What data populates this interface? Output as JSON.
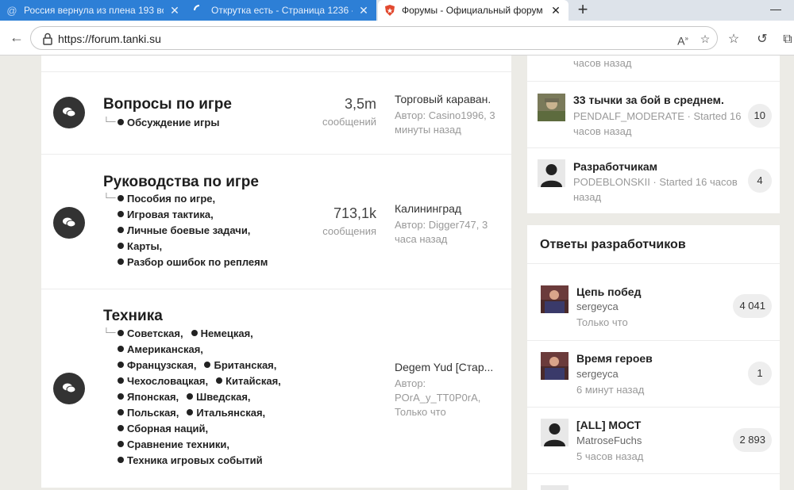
{
  "browser": {
    "tabs": [
      {
        "label": "Россия вернула из плена 193 вое",
        "icon": "at-icon"
      },
      {
        "label": "Открутка есть - Страница 1236 -",
        "icon": "loading-icon"
      },
      {
        "label": "Форумы - Официальный форум",
        "icon": "tanki-shield-icon"
      }
    ],
    "url": "https://forum.tanki.su"
  },
  "forums": [
    {
      "title": "Вопросы по игре",
      "subforums": [
        [
          "Обсуждение игры"
        ]
      ],
      "count": "3,5m",
      "count_label": "сообщений",
      "last_title": "Торговый караван.",
      "last_meta": "Автор: Casino1996, 3 минуты назад"
    },
    {
      "title": "Руководства по игре",
      "subforums": [
        [
          "Пособия по игре,"
        ],
        [
          "Игровая тактика,"
        ],
        [
          "Личные боевые задачи,"
        ],
        [
          "Карты,"
        ],
        [
          "Разбор ошибок по реплеям"
        ]
      ],
      "count": "713,1k",
      "count_label": "сообщения",
      "last_title": "Калининград",
      "last_meta": "Автор: Digger747, 3 часа назад"
    },
    {
      "title": "Техника",
      "subforums": [
        [
          "Советская,",
          "Немецкая,"
        ],
        [
          "Американская,"
        ],
        [
          "Французская,",
          "Британская,"
        ],
        [
          "Чехословацкая,",
          "Китайская,"
        ],
        [
          "Японская,",
          "Шведская,"
        ],
        [
          "Польская,",
          "Итальянская,"
        ],
        [
          "Сборная наций,"
        ],
        [
          "Сравнение техники,"
        ],
        [
          "Техника игровых событий"
        ]
      ],
      "count": "",
      "count_label": "",
      "last_title": "Degem Yud [Стар...",
      "last_meta": "Автор: POrA_y_TT0P0rA, Только что"
    }
  ],
  "popular": {
    "top_fragment": "часов назад",
    "items": [
      {
        "title": "33 тычки за бой в среднем.",
        "meta": "PENDALF_MODERATE · Started 16 часов назад",
        "count": "10"
      },
      {
        "title": "Разработчикам",
        "meta": "PODEBLONSKII · Started 16 часов назад",
        "count": "4"
      }
    ]
  },
  "dev_answers": {
    "heading": "Ответы разработчиков",
    "items": [
      {
        "title": "Цепь побед",
        "author": "sergeyca",
        "time": "Только что",
        "count": "4 041"
      },
      {
        "title": "Время героев",
        "author": "sergeyca",
        "time": "6 минут назад",
        "count": "1"
      },
      {
        "title": "[ALL] МОСТ",
        "author": "MatroseFuchs",
        "time": "5 часов назад",
        "count": "2 893"
      }
    ]
  }
}
